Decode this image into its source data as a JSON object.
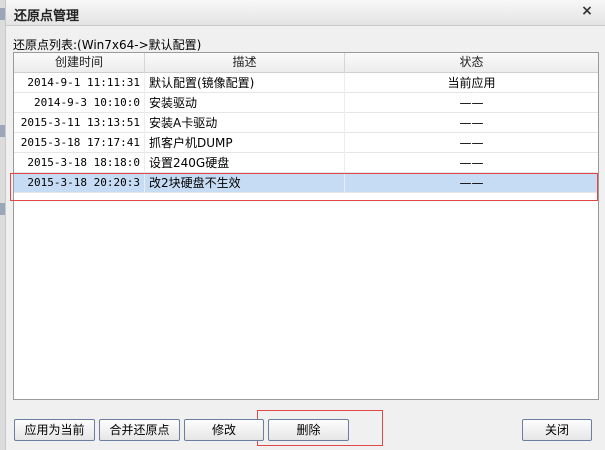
{
  "dialog": {
    "title": "还原点管理",
    "close_glyph": "×"
  },
  "list_label": "还原点列表:(Win7x64->默认配置)",
  "table": {
    "headers": [
      "创建时间",
      "描述",
      "状态"
    ],
    "rows": [
      {
        "time": "2014-9-1 11:11:31",
        "desc": "默认配置(镜像配置)",
        "status": "当前应用",
        "selected": false
      },
      {
        "time": "2014-9-3 10:10:0",
        "desc": "安装驱动",
        "status": "——",
        "selected": false
      },
      {
        "time": "2015-3-11 13:13:51",
        "desc": "安装A卡驱动",
        "status": "——",
        "selected": false
      },
      {
        "time": "2015-3-18 17:17:41",
        "desc": "抓客户机DUMP",
        "status": "——",
        "selected": false
      },
      {
        "time": "2015-3-18 18:18:0",
        "desc": "设置240G硬盘",
        "status": "——",
        "selected": false
      },
      {
        "time": "2015-3-18 20:20:3",
        "desc": "改2块硬盘不生效",
        "status": "——",
        "selected": true
      }
    ]
  },
  "buttons": {
    "apply_current": "应用为当前",
    "merge": "合并还原点",
    "modify": "修改",
    "delete": "删除",
    "close": "关闭"
  },
  "colors": {
    "selection": "#c6dcf5",
    "highlight_annotation": "#e04848"
  }
}
